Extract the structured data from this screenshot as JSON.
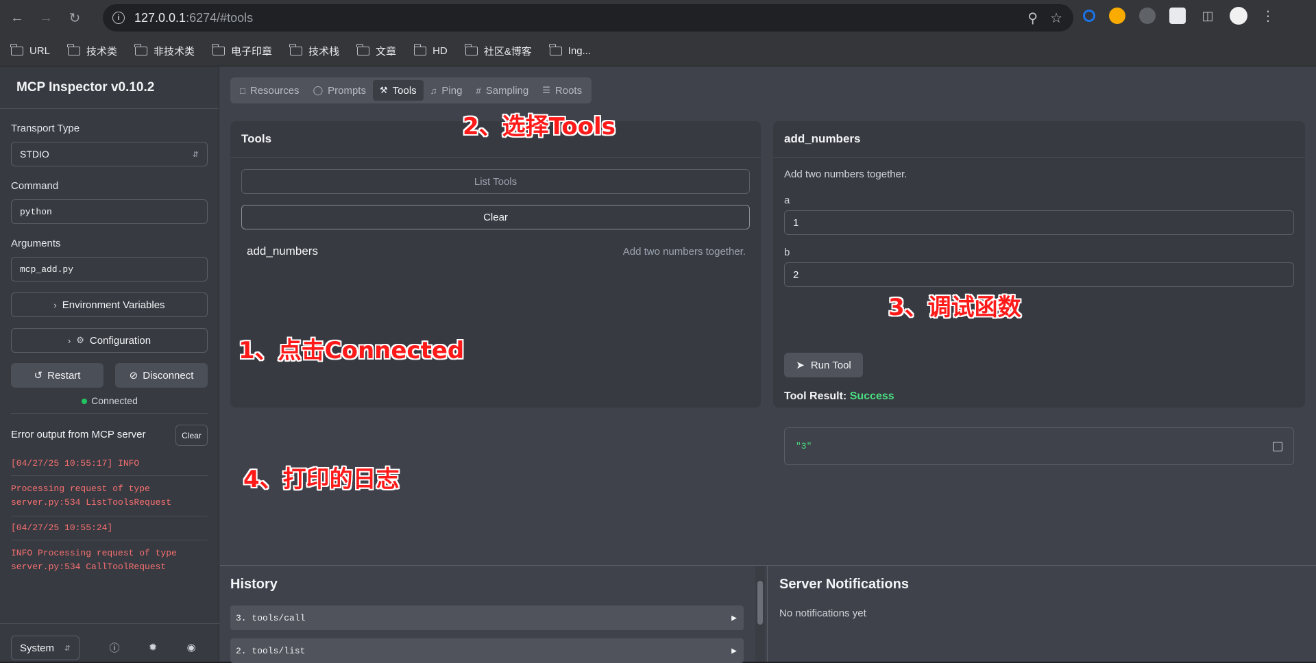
{
  "browser": {
    "url_host": "127.0.0.1",
    "url_rest": ":6274/#tools",
    "bookmarks": [
      "URL",
      "技术类",
      "非技术类",
      "电子印章",
      "技术栈",
      "文章",
      "HD",
      "社区&博客",
      "Ing..."
    ]
  },
  "sidebar": {
    "title": "MCP Inspector v0.10.2",
    "transport_label": "Transport Type",
    "transport_value": "STDIO",
    "command_label": "Command",
    "command_value": "python",
    "arguments_label": "Arguments",
    "arguments_value": "mcp_add.py",
    "env_button": "Environment Variables",
    "config_button": "Configuration",
    "restart_button": "Restart",
    "disconnect_button": "Disconnect",
    "status": "Connected",
    "error_title": "Error output from MCP server",
    "error_clear": "Clear",
    "logs": [
      "[04/27/25 10:55:17] INFO",
      "Processing request of type server.py:534 ListToolsRequest",
      "[04/27/25 10:55:24]",
      "INFO Processing request of type server.py:534 CallToolRequest"
    ],
    "theme_value": "System"
  },
  "tabs": [
    {
      "label": "Resources",
      "icon": "file-icon"
    },
    {
      "label": "Prompts",
      "icon": "message-icon"
    },
    {
      "label": "Tools",
      "icon": "hammer-icon"
    },
    {
      "label": "Ping",
      "icon": "bell-icon"
    },
    {
      "label": "Sampling",
      "icon": "hash-icon"
    },
    {
      "label": "Roots",
      "icon": "folder-tree-icon"
    }
  ],
  "tools_panel": {
    "title": "Tools",
    "list_button": "List Tools",
    "clear_button": "Clear",
    "tool_name": "add_numbers",
    "tool_desc": "Add two numbers together."
  },
  "tool_detail": {
    "title": "add_numbers",
    "description": "Add two numbers together.",
    "param_a_label": "a",
    "param_a_value": "1",
    "param_b_label": "b",
    "param_b_value": "2",
    "run_button": "Run Tool",
    "result_label": "Tool Result:",
    "result_status": "Success",
    "result_value": "\"3\""
  },
  "annotations": {
    "a1": "1、点击Connected",
    "a2": "2、选择Tools",
    "a3": "3、调试函数",
    "a4": "4、打印的日志"
  },
  "history": {
    "title": "History",
    "items": [
      "3. tools/call",
      "2. tools/list"
    ]
  },
  "notifications": {
    "title": "Server Notifications",
    "empty": "No notifications yet"
  },
  "colors": {
    "success": "#4ade80",
    "connected_dot": "#22c55e",
    "log_text": "#f87171",
    "annotation": "#ff1a1a"
  }
}
